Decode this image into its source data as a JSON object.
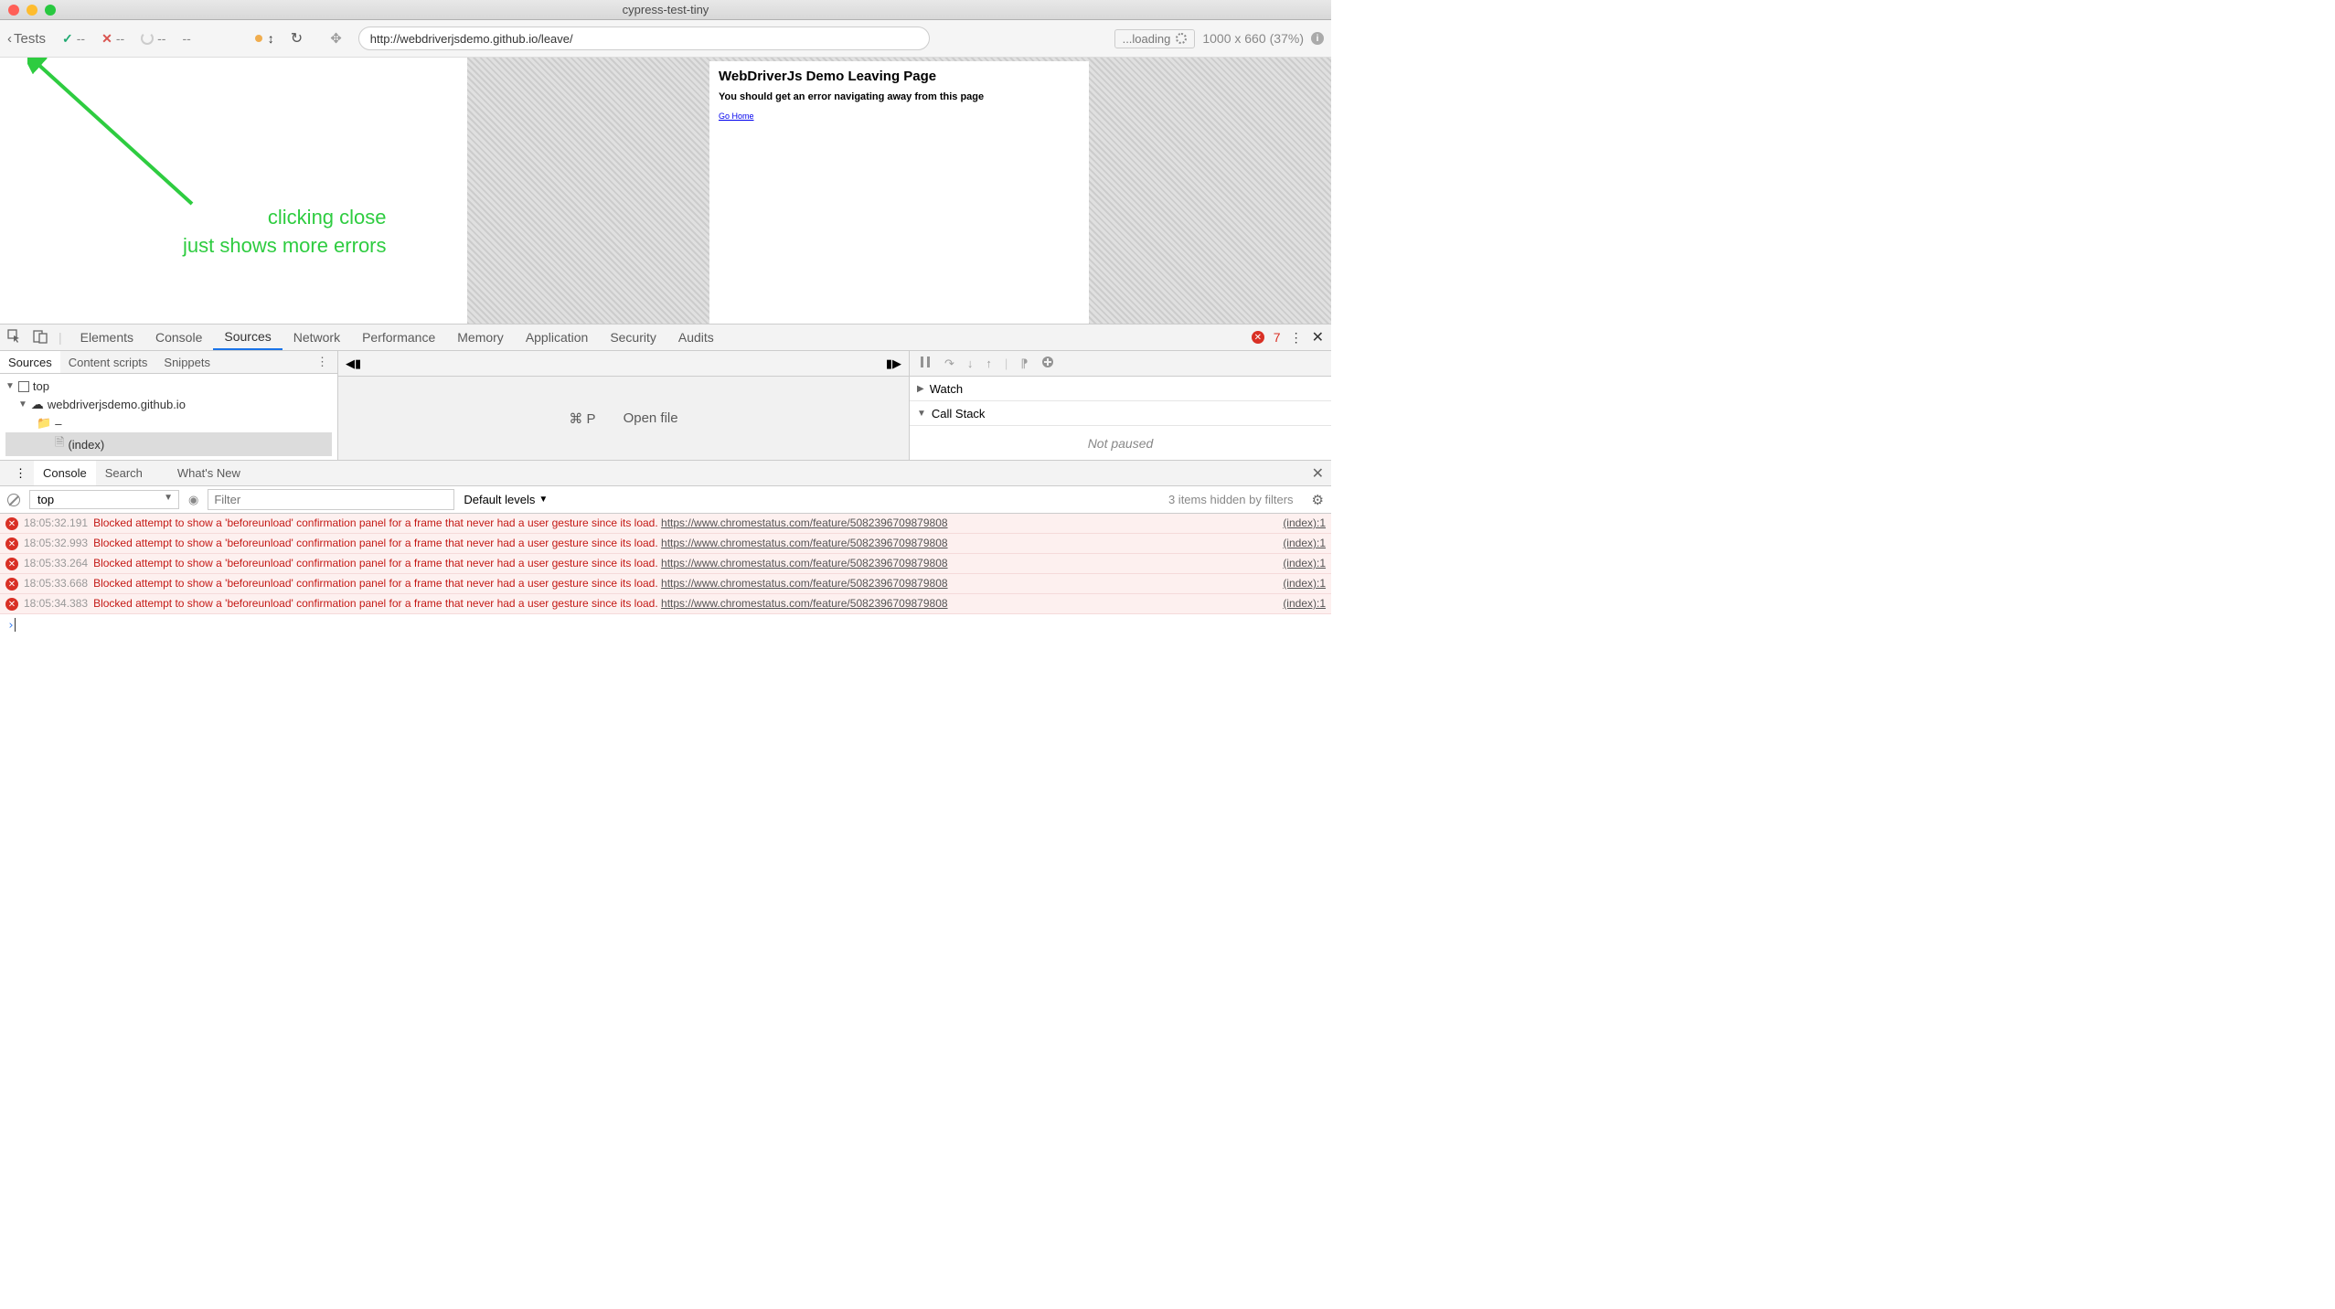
{
  "window": {
    "title": "cypress-test-tiny"
  },
  "cypress": {
    "back_label": "Tests",
    "pass_count": "--",
    "fail_count": "--",
    "pending_count": "--",
    "duration": "--",
    "url": "http://webdriverjsdemo.github.io/leave/",
    "loading": "...loading",
    "viewport": "1000 x 660",
    "scale": "(37%)"
  },
  "annotation": {
    "line1": "clicking close",
    "line2": "just shows more errors"
  },
  "iframe": {
    "heading": "WebDriverJs Demo Leaving Page",
    "sub": "You should get an error navigating away from this page",
    "link": "Go Home"
  },
  "devtools": {
    "tabs": [
      "Elements",
      "Console",
      "Sources",
      "Network",
      "Performance",
      "Memory",
      "Application",
      "Security",
      "Audits"
    ],
    "active_tab": "Sources",
    "error_count": "7"
  },
  "sources": {
    "subtabs": [
      "Sources",
      "Content scripts",
      "Snippets"
    ],
    "tree": {
      "top": "top",
      "domain": "webdriverjsdemo.github.io",
      "folder": "–",
      "file": "(index)"
    },
    "open_shortcut": "⌘ P",
    "open_label": "Open file",
    "watch": "Watch",
    "callstack": "Call Stack",
    "not_paused": "Not paused"
  },
  "drawer": {
    "tabs": [
      "Console",
      "Search",
      "What's New"
    ]
  },
  "console": {
    "context": "top",
    "filter_placeholder": "Filter",
    "levels": "Default levels",
    "hidden": "3 items hidden by filters",
    "entries": [
      {
        "ts": "18:05:32.191",
        "msg": "Blocked attempt to show a 'beforeunload' confirmation panel for a frame that never had a user gesture since its load.",
        "link": "https://www.chromestatus.com/feature/5082396709879808",
        "src": "(index):1"
      },
      {
        "ts": "18:05:32.993",
        "msg": "Blocked attempt to show a 'beforeunload' confirmation panel for a frame that never had a user gesture since its load.",
        "link": "https://www.chromestatus.com/feature/5082396709879808",
        "src": "(index):1"
      },
      {
        "ts": "18:05:33.264",
        "msg": "Blocked attempt to show a 'beforeunload' confirmation panel for a frame that never had a user gesture since its load.",
        "link": "https://www.chromestatus.com/feature/5082396709879808",
        "src": "(index):1"
      },
      {
        "ts": "18:05:33.668",
        "msg": "Blocked attempt to show a 'beforeunload' confirmation panel for a frame that never had a user gesture since its load.",
        "link": "https://www.chromestatus.com/feature/5082396709879808",
        "src": "(index):1"
      },
      {
        "ts": "18:05:34.383",
        "msg": "Blocked attempt to show a 'beforeunload' confirmation panel for a frame that never had a user gesture since its load.",
        "link": "https://www.chromestatus.com/feature/5082396709879808",
        "src": "(index):1"
      }
    ]
  }
}
